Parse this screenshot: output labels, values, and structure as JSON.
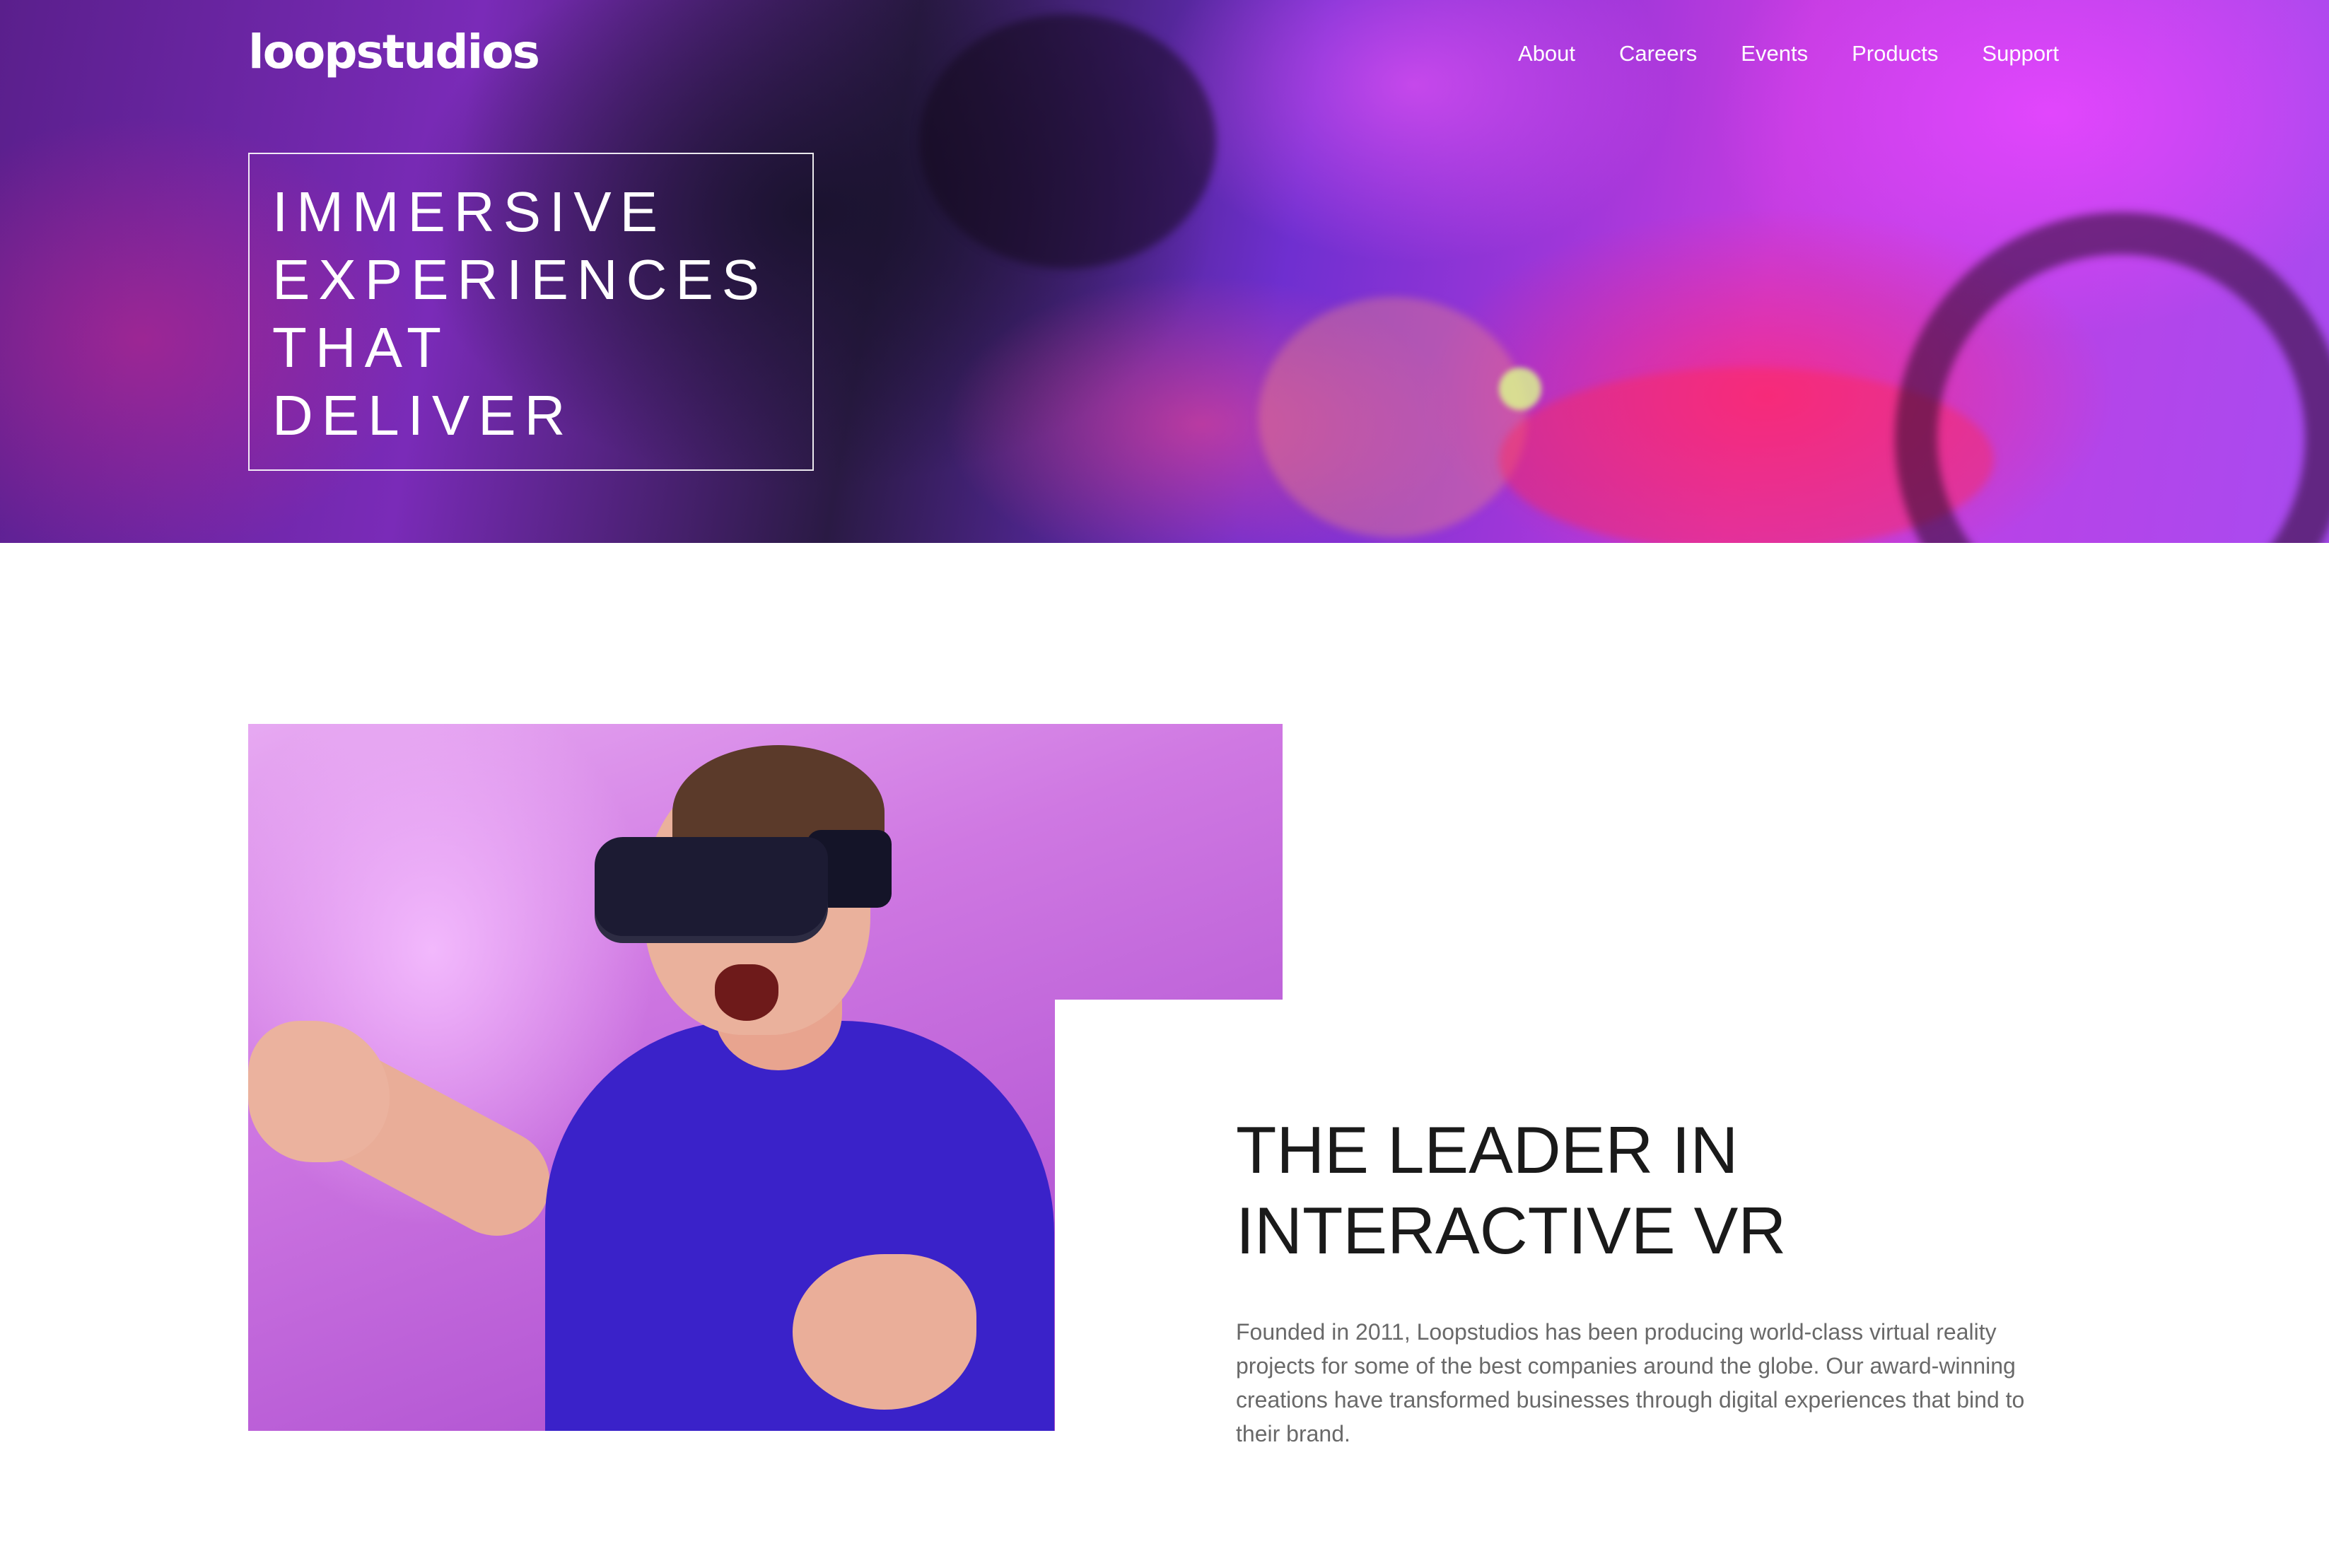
{
  "header": {
    "logo": "loopstudios",
    "nav": [
      "About",
      "Careers",
      "Events",
      "Products",
      "Support"
    ]
  },
  "hero": {
    "title_lines": [
      "IMMERSIVE",
      "EXPERIENCES",
      "THAT",
      "DELIVER"
    ]
  },
  "intro": {
    "heading_lines": [
      "THE LEADER IN",
      "INTERACTIVE VR"
    ],
    "body": "Founded in 2011, Loopstudios has been producing world-class virtual reality projects for some of the best companies around the globe. Our award-winning creations have transformed businesses through digital experiences that bind to their brand."
  },
  "colors": {
    "background": "#ffffff",
    "hero_text": "#ffffff",
    "heading_text": "#1a1a1a",
    "body_text": "#696969"
  }
}
